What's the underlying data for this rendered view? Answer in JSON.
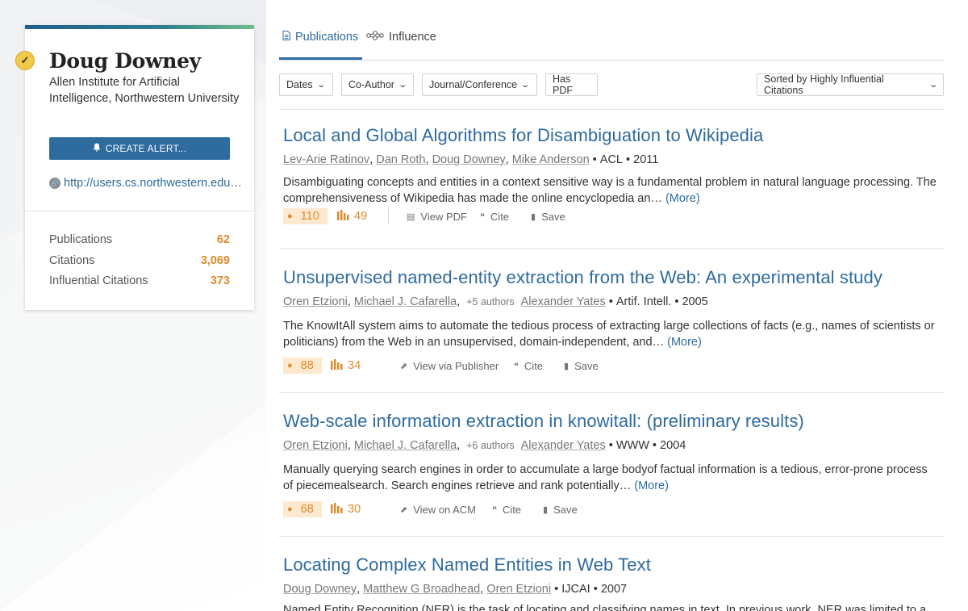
{
  "author": {
    "name": "Doug Downey",
    "affiliation": "Allen Institute for Artificial Intelligence, Northwestern University",
    "alert_label": "CREATE ALERT...",
    "homepage": "http://users.cs.northwestern.edu/~ddowney/",
    "stats": [
      {
        "label": "Publications",
        "value": "62"
      },
      {
        "label": "Citations",
        "value": "3,069"
      },
      {
        "label": "Influential Citations",
        "value": "373"
      }
    ]
  },
  "tabs": {
    "publications": "Publications",
    "influence": "Influence"
  },
  "filters": {
    "dates": "Dates",
    "coauthor": "Co-Author",
    "venue": "Journal/Conference",
    "has_pdf": "Has PDF",
    "sort": "Sorted by Highly Influential Citations"
  },
  "papers": [
    {
      "title": "Local and Global Algorithms for Disambiguation to Wikipedia",
      "authors": [
        "Lev-Arie Ratinov",
        "Dan Roth",
        "Doug Downey",
        "Mike Anderson"
      ],
      "venue": "ACL",
      "year": "2011",
      "abstract": "Disambiguating concepts and entities in a context sensitive way is a fundamental problem in natural language processing. The comprehensiveness of Wikipedia has made the online encyclopedia an…",
      "more": "(More)",
      "influential": "110",
      "citations": "49",
      "view_label": "View PDF",
      "cite": "Cite",
      "save": "Save"
    },
    {
      "title": "Unsupervised named-entity extraction from the Web: An experimental study",
      "authors": [
        "Oren Etzioni",
        "Michael J. Cafarella"
      ],
      "more_authors": "+5 authors",
      "last_author": "Alexander Yates",
      "venue": "Artif. Intell.",
      "year": "2005",
      "abstract": "The KnowItAll system aims to automate the tedious process of extracting large collections of facts (e.g., names of scientists or politicians) from the Web in an unsupervised, domain-independent, and…",
      "more": "(More)",
      "influential": "88",
      "citations": "34",
      "view_label": "View via Publisher",
      "cite": "Cite",
      "save": "Save"
    },
    {
      "title": "Web-scale information extraction in knowitall: (preliminary results)",
      "authors": [
        "Oren Etzioni",
        "Michael J. Cafarella"
      ],
      "more_authors": "+6 authors",
      "last_author": "Alexander Yates",
      "venue": "WWW",
      "year": "2004",
      "abstract": "Manually querying search engines in order to accumulate a large bodyof factual information is a tedious, error-prone process of piecemealsearch. Search engines retrieve and rank potentially…",
      "more": "(More)",
      "influential": "68",
      "citations": "30",
      "view_label": "View on ACM",
      "cite": "Cite",
      "save": "Save"
    },
    {
      "title": "Locating Complex Named Entities in Web Text",
      "authors": [
        "Doug Downey",
        "Matthew G Broadhead",
        "Oren Etzioni"
      ],
      "venue": "IJCAI",
      "year": "2007",
      "abstract": "Named Entity Recognition (NER) is the task of locating and classifying names in text. In previous work, NER was limited to a"
    }
  ]
}
